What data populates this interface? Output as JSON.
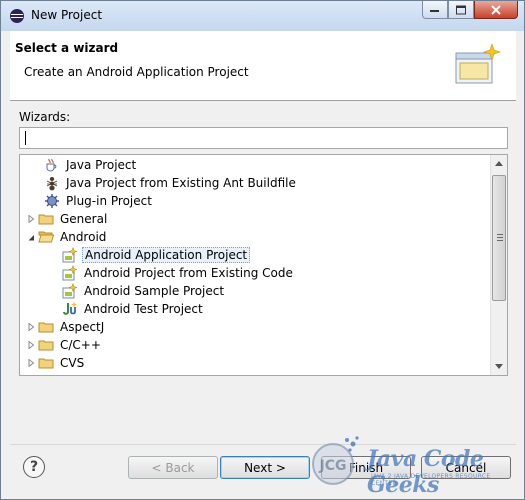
{
  "window": {
    "title": "New Project"
  },
  "banner": {
    "title": "Select a wizard",
    "description": "Create an Android Application Project"
  },
  "wizards": {
    "label": "Wizards:",
    "filter_value": "",
    "items": [
      {
        "label": "Java Project",
        "icon": "java-project-icon",
        "expander": "none"
      },
      {
        "label": "Java Project from Existing Ant Buildfile",
        "icon": "ant-icon",
        "expander": "none"
      },
      {
        "label": "Plug-in Project",
        "icon": "plugin-icon",
        "expander": "none"
      },
      {
        "label": "General",
        "icon": "folder-icon",
        "expander": "collapsed"
      },
      {
        "label": "Android",
        "icon": "folder-open-icon",
        "expander": "expanded"
      },
      {
        "label": "Android Application Project",
        "icon": "android-project-icon",
        "expander": "none",
        "selected": true
      },
      {
        "label": "Android Project from Existing Code",
        "icon": "android-project-icon",
        "expander": "none"
      },
      {
        "label": "Android Sample Project",
        "icon": "android-project-icon",
        "expander": "none"
      },
      {
        "label": "Android Test Project",
        "icon": "junit-icon",
        "expander": "none"
      },
      {
        "label": "AspectJ",
        "icon": "folder-icon",
        "expander": "collapsed"
      },
      {
        "label": "C/C++",
        "icon": "folder-icon",
        "expander": "collapsed"
      },
      {
        "label": "CVS",
        "icon": "folder-icon",
        "expander": "collapsed"
      }
    ]
  },
  "buttons": {
    "help": "?",
    "back": "< Back",
    "next": "Next >",
    "finish": "Finish",
    "cancel": "Cancel"
  },
  "watermark": {
    "text": "Java Code Geeks",
    "subtext": "JAVA 2 JAVA DEVELOPERS RESOURCE CENTER"
  },
  "colors": {
    "selection_bg": "#e8f0fa",
    "folder": "#e8c25a",
    "watermark": "#4678be"
  }
}
